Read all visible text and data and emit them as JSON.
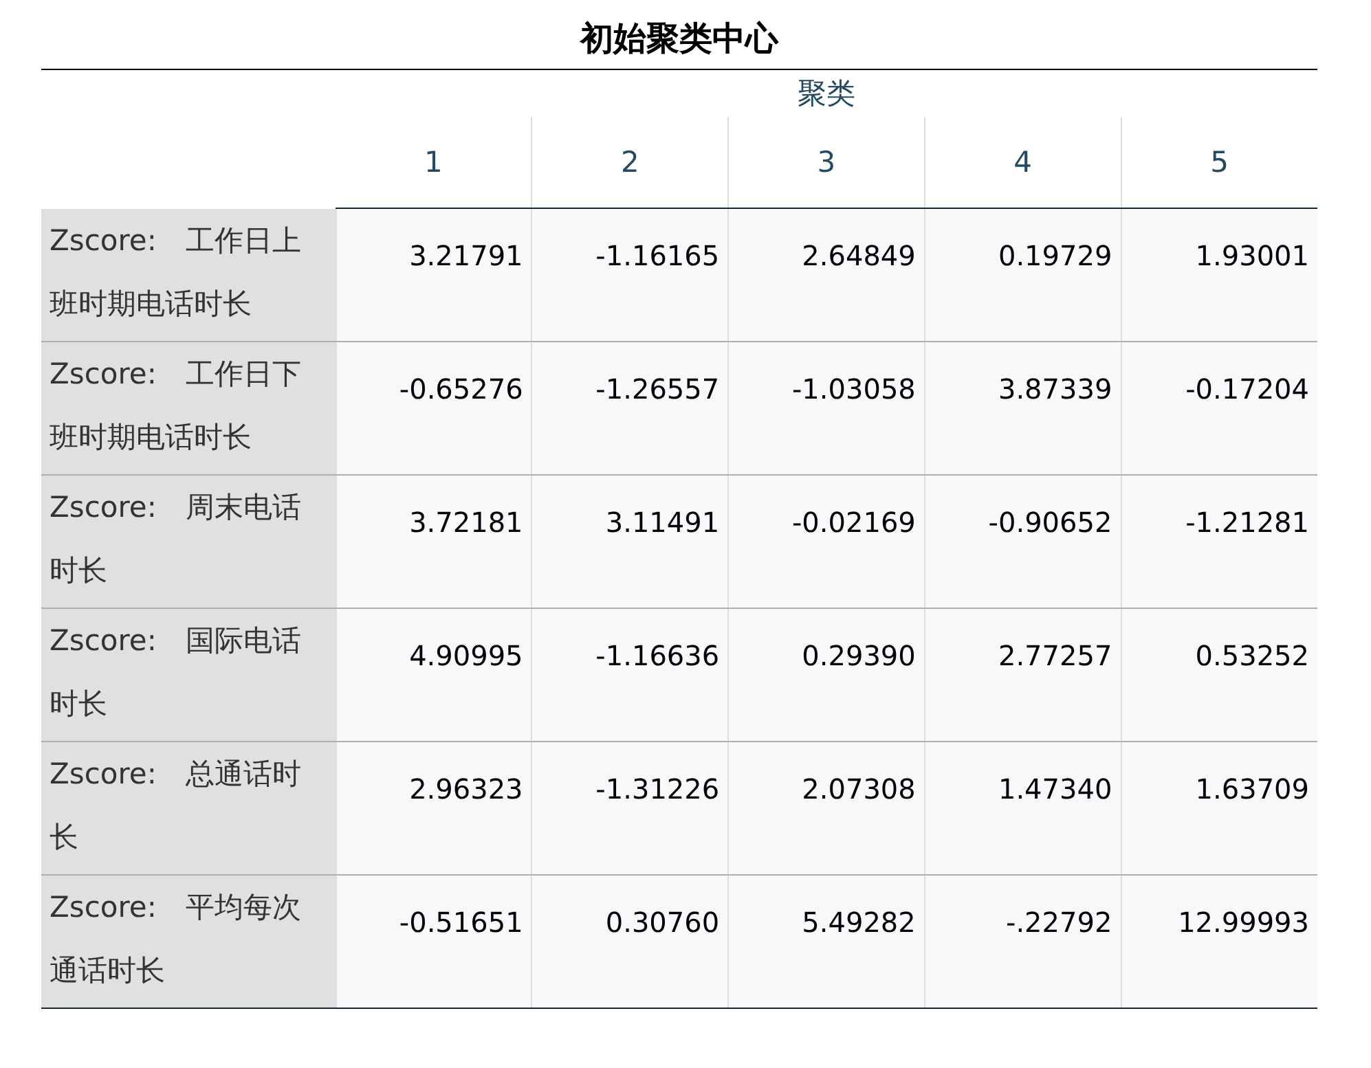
{
  "title": "初始聚类中心",
  "table": {
    "group_header": "聚类",
    "columns": [
      "1",
      "2",
      "3",
      "4",
      "5"
    ],
    "rows": [
      {
        "label": "Zscore:　工作日上班时期电话时长",
        "values": [
          "3.21791",
          "-1.16165",
          "2.64849",
          "0.19729",
          "1.93001"
        ]
      },
      {
        "label": "Zscore:　工作日下班时期电话时长",
        "values": [
          "-0.65276",
          "-1.26557",
          "-1.03058",
          "3.87339",
          "-0.17204"
        ]
      },
      {
        "label": "Zscore:　周末电话时长",
        "values": [
          "3.72181",
          "3.11491",
          "-0.02169",
          "-0.90652",
          "-1.21281"
        ]
      },
      {
        "label": "Zscore:　国际电话时长",
        "values": [
          "4.90995",
          "-1.16636",
          "0.29390",
          "2.77257",
          "0.53252"
        ]
      },
      {
        "label": "Zscore:　总通话时长",
        "values": [
          "2.96323",
          "-1.31226",
          "2.07308",
          "1.47340",
          "1.63709"
        ]
      },
      {
        "label": "Zscore:　平均每次通话时长",
        "values": [
          "-0.51651",
          "0.30760",
          "5.49282",
          "-.22792",
          "12.99993"
        ]
      }
    ]
  }
}
